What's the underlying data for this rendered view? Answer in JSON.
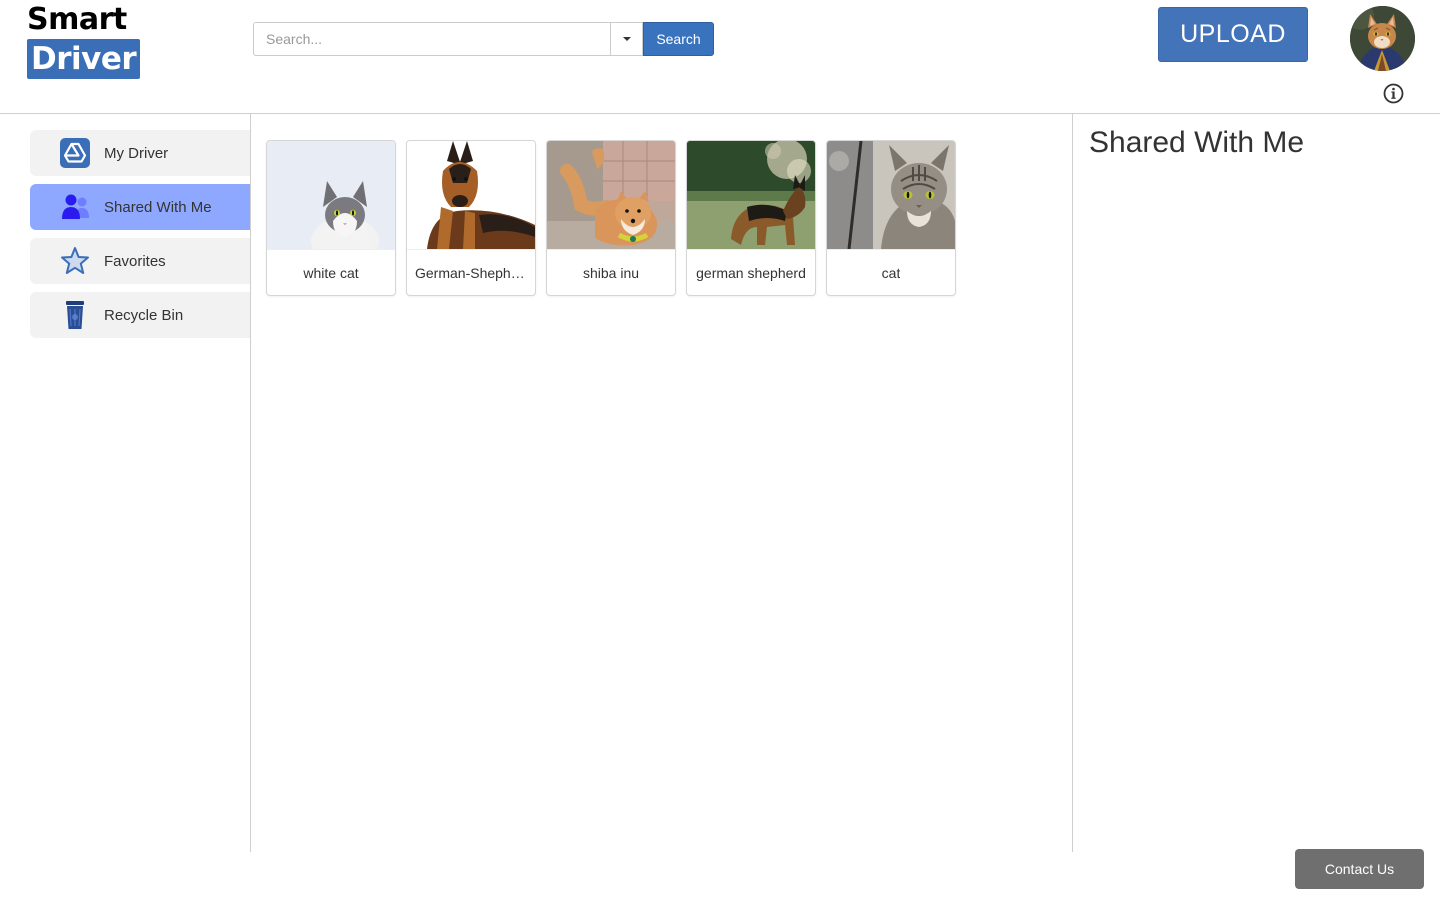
{
  "app": {
    "logo_top": "Smart",
    "logo_bottom": "Driver"
  },
  "search": {
    "placeholder": "Search...",
    "value": "",
    "button_label": "Search"
  },
  "header": {
    "upload_label": "UPLOAD",
    "info_icon": "info-circle-icon",
    "avatar_icon": "user-avatar"
  },
  "sidebar": {
    "items": [
      {
        "label": "My Driver",
        "icon": "drive-icon",
        "active": false
      },
      {
        "label": "Shared With Me",
        "icon": "shared-users-icon",
        "active": true
      },
      {
        "label": "Favorites",
        "icon": "star-icon",
        "active": false
      },
      {
        "label": "Recycle Bin",
        "icon": "trash-bin-icon",
        "active": false
      }
    ]
  },
  "files": [
    {
      "name": "white cat"
    },
    {
      "name": "German-Shepherd"
    },
    {
      "name": "shiba inu"
    },
    {
      "name": "german shepherd"
    },
    {
      "name": "cat"
    }
  ],
  "detail": {
    "title": "Shared With Me"
  },
  "footer": {
    "contact_label": "Contact Us"
  },
  "colors": {
    "brand": "#3a6fb8",
    "upload": "#4374b9",
    "active_nav": "#8fa8ff",
    "contact": "#6f6f6f"
  }
}
